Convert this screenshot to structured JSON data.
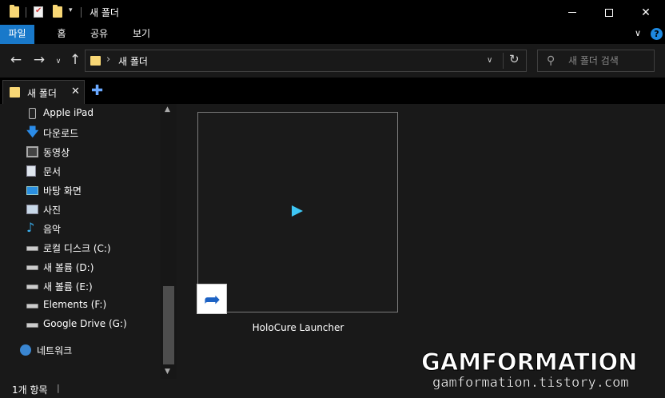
{
  "window": {
    "title": "새 폴더",
    "minimize_icon": "minimize-icon",
    "maximize_icon": "maximize-icon",
    "close_glyph": "✕"
  },
  "quick_access": {
    "dropdown_glyph": "▾"
  },
  "ribbon": {
    "tabs": [
      {
        "label": "파일",
        "active": true
      },
      {
        "label": "홈"
      },
      {
        "label": "공유"
      },
      {
        "label": "보기"
      }
    ],
    "expand_glyph": "∨",
    "help_glyph": "?",
    "accent_color": "#1979ca"
  },
  "navigation": {
    "back_glyph": "←",
    "forward_glyph": "→",
    "recent_glyph": "∨",
    "up_glyph": "↑",
    "address_separator": "›",
    "address_path": "새 폴더",
    "address_dropdown_glyph": "∨",
    "refresh_glyph": "↻",
    "search_placeholder": "새 폴더 검색",
    "search_glyph": "⚲"
  },
  "tabs": {
    "current": "새 폴더",
    "close_glyph": "✕",
    "add_glyph": "✚"
  },
  "sidebar": {
    "items": [
      {
        "label": "Apple iPad",
        "icon": "phone-icon"
      },
      {
        "label": "다운로드",
        "icon": "download-icon",
        "glyph": "🡇"
      },
      {
        "label": "동영상",
        "icon": "video-icon"
      },
      {
        "label": "문서",
        "icon": "document-icon"
      },
      {
        "label": "바탕 화면",
        "icon": "desktop-icon"
      },
      {
        "label": "사진",
        "icon": "pictures-icon"
      },
      {
        "label": "음악",
        "icon": "music-icon",
        "glyph": "♪"
      },
      {
        "label": "로컬 디스크 (C:)",
        "icon": "drive-icon"
      },
      {
        "label": "새 볼륨 (D:)",
        "icon": "drive-icon"
      },
      {
        "label": "새 볼륨 (E:)",
        "icon": "drive-icon"
      },
      {
        "label": "Elements (F:)",
        "icon": "drive-icon"
      },
      {
        "label": "Google Drive (G:)",
        "icon": "drive-icon"
      },
      {
        "label": "네트워크",
        "icon": "network-icon"
      }
    ],
    "scroll_up_glyph": "▲",
    "scroll_down_glyph": "▼"
  },
  "content": {
    "files": [
      {
        "name": "HoloCure Launcher",
        "type": "shortcut",
        "icon": "play-icon",
        "shortcut_glyph": "➦"
      }
    ]
  },
  "status": {
    "item_count": "1개 항목",
    "separator": "|"
  },
  "watermark": {
    "title": "GAMFORMATION",
    "url": "gamformation.tistory.com"
  }
}
